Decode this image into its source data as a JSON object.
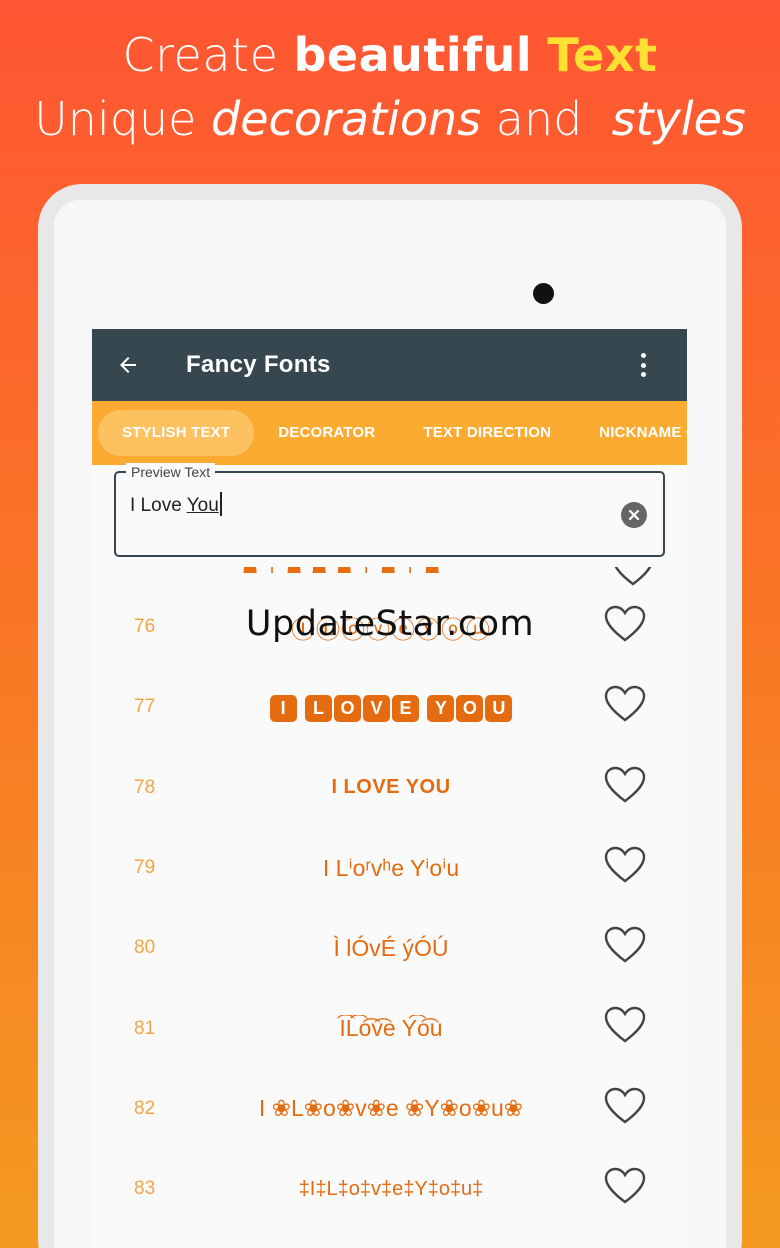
{
  "promo": {
    "line1_prefix": "Create ",
    "line1_bold": "beautiful",
    "line1_accent": "Text",
    "line2_part1": "Unique ",
    "line2_italic1": "decorations",
    "line2_part2": " and  ",
    "line2_italic2": "styles"
  },
  "appbar": {
    "title": "Fancy Fonts",
    "back_icon": "arrow-left-icon",
    "menu_icon": "more-vertical-icon"
  },
  "tabs": [
    {
      "label": "Stylish Text",
      "active": true
    },
    {
      "label": "Decorator",
      "active": false
    },
    {
      "label": "Text Direction",
      "active": false
    },
    {
      "label": "Nickname Cre",
      "active": false
    }
  ],
  "preview": {
    "label": "Preview Text",
    "value_plain": "I Love ",
    "value_underlined": "You"
  },
  "list": {
    "cut_text": "☗ ☨ ☗ ☗ ☗ ☨ ☗ ☨ ☗",
    "items": [
      {
        "number": "76",
        "text": "ⒾⓁⓞⓥⓔⓎⓞⓤ"
      },
      {
        "number": "77",
        "text": "ILOVEYOU"
      },
      {
        "number": "78",
        "text": "I LOVE YOU"
      },
      {
        "number": "79",
        "text": "I Lⁱoʳvʰe Yⁱoⁱu"
      },
      {
        "number": "80",
        "text": "Ì lÓvÉ ýÓÚ"
      },
      {
        "number": "81",
        "text": "I͡L͡o͡v͡e Y͡o͡u"
      },
      {
        "number": "82",
        "text": "I ❀L❀o❀v❀e ❀Y❀o❀u❀"
      },
      {
        "number": "83",
        "text": "‡I‡L‡o‡v‡e‡Y‡o‡u‡"
      }
    ]
  },
  "watermark": "UpdateStar.com",
  "colors": {
    "background_top": "#ff5533",
    "background_bottom": "#f39a20",
    "appbar": "#37474f",
    "tabs": "#fbab32",
    "fancy_text": "#e46b0f",
    "number": "#f0a545"
  }
}
